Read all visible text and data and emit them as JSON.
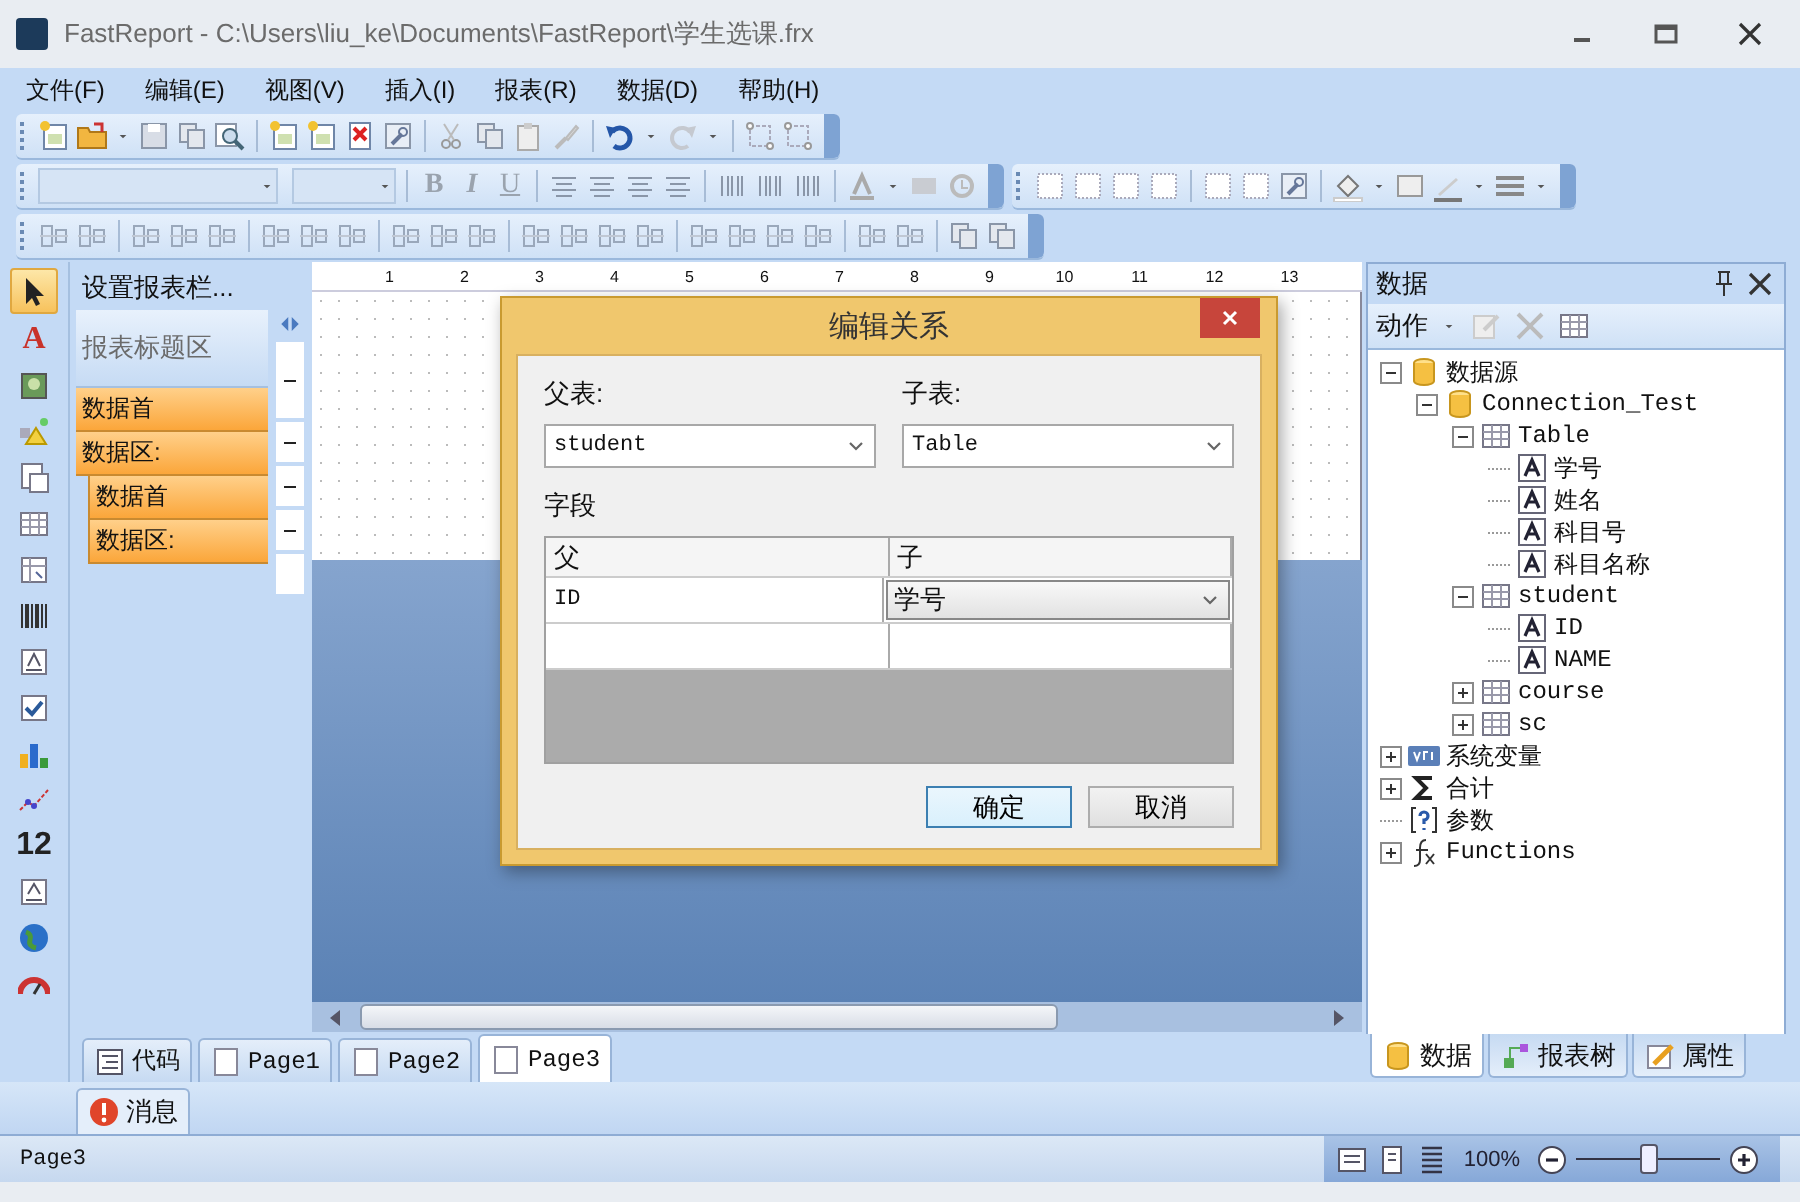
{
  "window": {
    "title": "FastReport - C:\\Users\\liu_ke\\Documents\\FastReport\\学生选课.frx"
  },
  "menu": [
    "文件(F)",
    "编辑(E)",
    "视图(V)",
    "插入(I)",
    "报表(R)",
    "数据(D)",
    "帮助(H)"
  ],
  "format_toolbar": {
    "text_buttons": [
      "B",
      "I",
      "U"
    ]
  },
  "tools": [
    {
      "kind": "pointer",
      "selected": true
    },
    {
      "kind": "text",
      "glyph": "A",
      "selected": false
    },
    {
      "kind": "picture",
      "selected": false
    },
    {
      "kind": "shapes",
      "selected": false
    },
    {
      "kind": "subreport",
      "selected": false
    },
    {
      "kind": "table",
      "selected": false
    },
    {
      "kind": "matrix",
      "selected": false
    },
    {
      "kind": "barcode",
      "selected": false
    },
    {
      "kind": "richtext",
      "selected": false
    },
    {
      "kind": "checkbox",
      "selected": false
    },
    {
      "kind": "chart",
      "selected": false
    },
    {
      "kind": "sparkline",
      "selected": false
    },
    {
      "kind": "digits",
      "glyph": "12",
      "selected": false
    },
    {
      "kind": "zipcode",
      "selected": false
    },
    {
      "kind": "globe",
      "selected": false
    },
    {
      "kind": "gauge",
      "selected": false
    }
  ],
  "bands_panel": {
    "header": "设置报表栏...",
    "bands": [
      {
        "label": "报表标题区",
        "kind": "title"
      },
      {
        "label": "数据首",
        "kind": "data"
      },
      {
        "label": "数据区:",
        "kind": "data",
        "children": [
          {
            "label": "数据首",
            "kind": "data"
          },
          {
            "label": "数据区:",
            "kind": "data"
          }
        ]
      }
    ]
  },
  "ruler": {
    "ticks": [
      "1",
      "2",
      "3",
      "4",
      "5",
      "6",
      "7",
      "8",
      "9",
      "10",
      "11",
      "12",
      "13"
    ]
  },
  "dialog": {
    "title": "编辑关系",
    "parent_label": "父表:",
    "parent_value": "student",
    "child_label": "子表:",
    "child_value": "Table",
    "fields_label": "字段",
    "columns": [
      "父",
      "子"
    ],
    "rows": [
      [
        "ID",
        "学号"
      ]
    ],
    "buttons": [
      {
        "label": "确定",
        "focused": true
      },
      {
        "label": "取消",
        "focused": false
      }
    ]
  },
  "page_tabs": [
    {
      "label": "代码",
      "kind": "code",
      "selected": false
    },
    {
      "label": "Page1",
      "kind": "page",
      "selected": false
    },
    {
      "label": "Page2",
      "kind": "page",
      "selected": false
    },
    {
      "label": "Page3",
      "kind": "page",
      "selected": true
    }
  ],
  "messages_tab": {
    "label": "消息"
  },
  "data_panel": {
    "title": "数据",
    "action": "动作",
    "tree": [
      {
        "label": "数据源",
        "kind": "datasource",
        "expanded": true,
        "children": [
          {
            "label": "Connection_Test",
            "kind": "datasource",
            "expanded": true,
            "children": [
              {
                "label": "Table",
                "kind": "table",
                "expanded": true,
                "children": [
                  {
                    "label": "学号",
                    "kind": "field"
                  },
                  {
                    "label": "姓名",
                    "kind": "field"
                  },
                  {
                    "label": "科目号",
                    "kind": "field"
                  },
                  {
                    "label": "科目名称",
                    "kind": "field"
                  }
                ]
              },
              {
                "label": "student",
                "kind": "table",
                "expanded": true,
                "children": [
                  {
                    "label": "ID",
                    "kind": "field"
                  },
                  {
                    "label": "NAME",
                    "kind": "field"
                  }
                ]
              },
              {
                "label": "course",
                "kind": "table",
                "expanded": false
              },
              {
                "label": "sc",
                "kind": "table",
                "expanded": false
              }
            ]
          }
        ]
      },
      {
        "label": "系统变量",
        "kind": "variables",
        "expanded": false
      },
      {
        "label": "合计",
        "kind": "totals",
        "expanded": false
      },
      {
        "label": "参数",
        "kind": "parameters"
      },
      {
        "label": "Functions",
        "kind": "functions",
        "expanded": false
      }
    ],
    "tabs": [
      {
        "label": "数据",
        "kind": "data",
        "selected": true
      },
      {
        "label": "报表树",
        "kind": "tree",
        "selected": false
      },
      {
        "label": "属性",
        "kind": "properties",
        "selected": false
      }
    ]
  },
  "status_bar": {
    "page": "Page3",
    "zoom": "100%",
    "zoom_slider": {
      "level": 0.5
    }
  }
}
